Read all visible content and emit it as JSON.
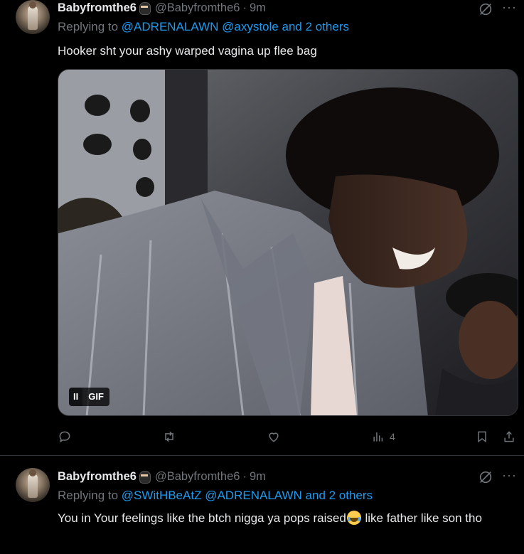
{
  "tweets": [
    {
      "display_name": "Babyfromthe6",
      "handle": "@Babyfromthe6",
      "time": "9m",
      "replying_prefix": "Replying to",
      "mentions": [
        "@ADRENALAWN",
        "@axystole"
      ],
      "others": "and 2 others",
      "text": "Hooker sht your ashy warped vagina up flee bag",
      "media": {
        "type": "gif",
        "badge_pause": "II",
        "badge_label": "GIF"
      },
      "actions": {
        "reply_count": "",
        "repost_count": "",
        "like_count": "",
        "views_count": "4"
      }
    },
    {
      "display_name": "Babyfromthe6",
      "handle": "@Babyfromthe6",
      "time": "9m",
      "replying_prefix": "Replying to",
      "mentions": [
        "@SWitHBeAtZ",
        "@ADRENALAWN"
      ],
      "others": "and 2 others",
      "text_part1": "You in Your feelings like the btch nigga ya pops raised",
      "text_part2": " like father like son tho"
    }
  ],
  "colors": {
    "background": "#000000",
    "text": "#e7e9ea",
    "muted": "#71767b",
    "link": "#1d9bf0",
    "divider": "#2f3336"
  },
  "icons": [
    "grok-icon",
    "more-icon",
    "reply-icon",
    "repost-icon",
    "like-icon",
    "views-icon",
    "bookmark-icon",
    "share-icon",
    "laughing-emoji",
    "ninja-emoji"
  ]
}
